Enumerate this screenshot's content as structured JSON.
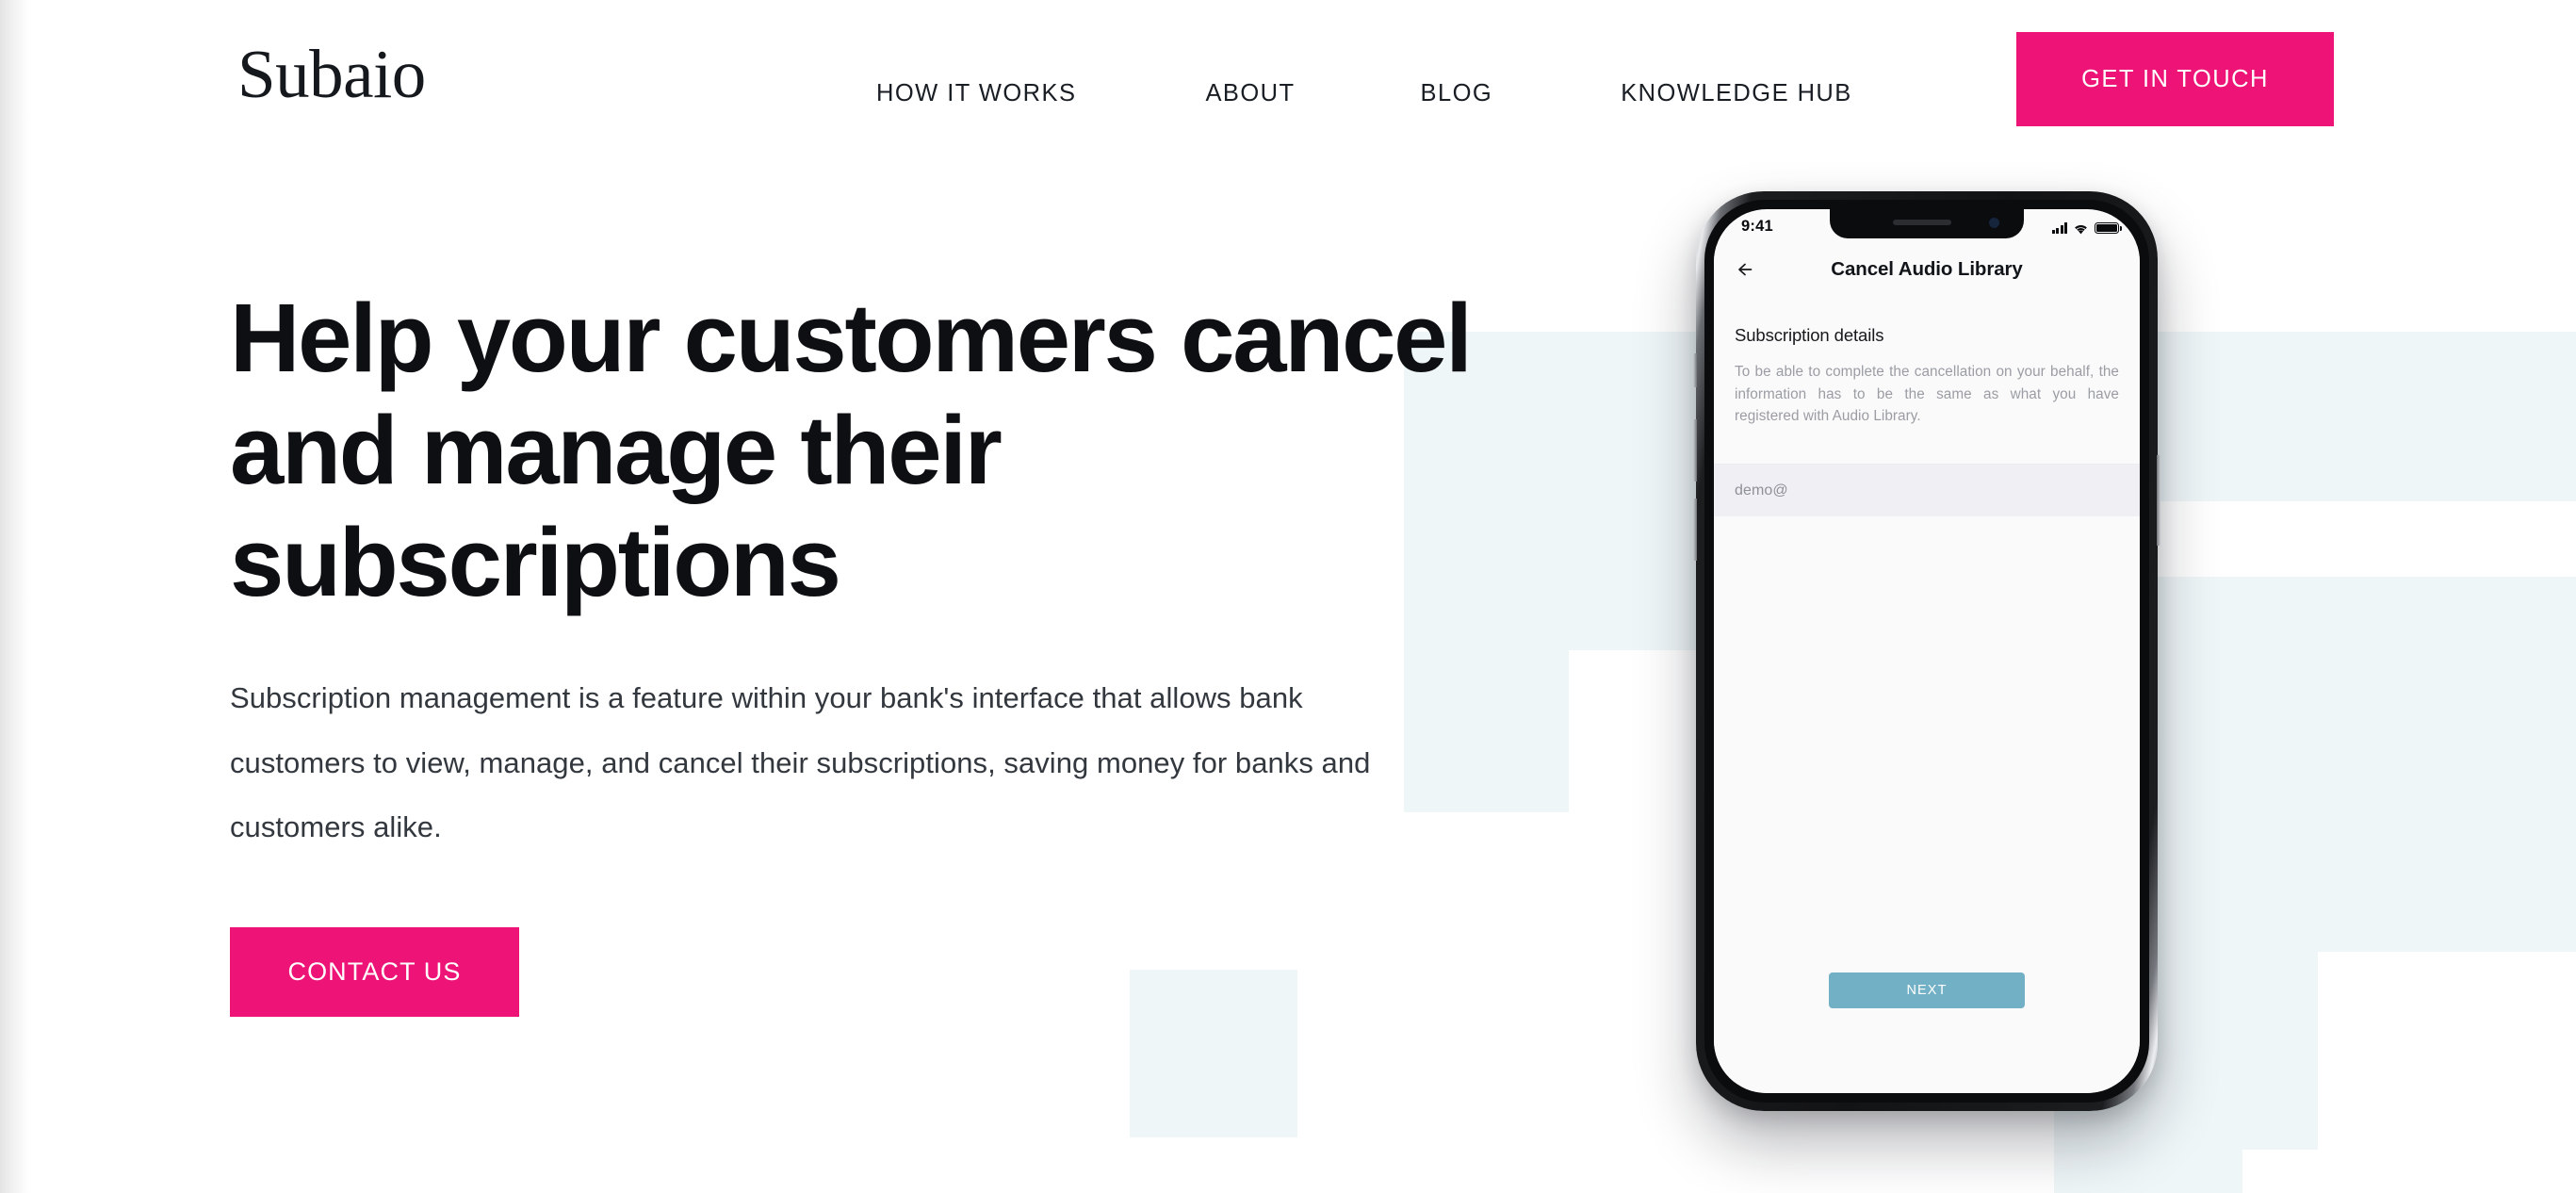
{
  "header": {
    "logo": "Subaio",
    "nav": [
      {
        "label": "HOW IT WORKS"
      },
      {
        "label": "ABOUT"
      },
      {
        "label": "BLOG"
      },
      {
        "label": "KNOWLEDGE HUB"
      }
    ],
    "cta": "GET IN TOUCH"
  },
  "hero": {
    "title": "Help your customers cancel and manage their subscriptions",
    "subtitle": "Subscription management is a feature within your bank's interface that allows bank customers to view, manage, and cancel their subscriptions, saving money for banks and customers alike.",
    "cta": "CONTACT US"
  },
  "phone": {
    "status": {
      "time": "9:41"
    },
    "appbar": {
      "title": "Cancel Audio Library"
    },
    "content": {
      "section_title": "Subscription details",
      "section_body": "To be able to complete the cancellation on your behalf, the information has to be the same as what you have registered with Audio Library.",
      "input_value": "demo@",
      "next_label": "NEXT"
    }
  },
  "colors": {
    "accent_pink": "#ED1377",
    "deco_blue": "#EFF6F8",
    "next_button": "#72B0C6",
    "text_dark": "#0d0f13"
  }
}
